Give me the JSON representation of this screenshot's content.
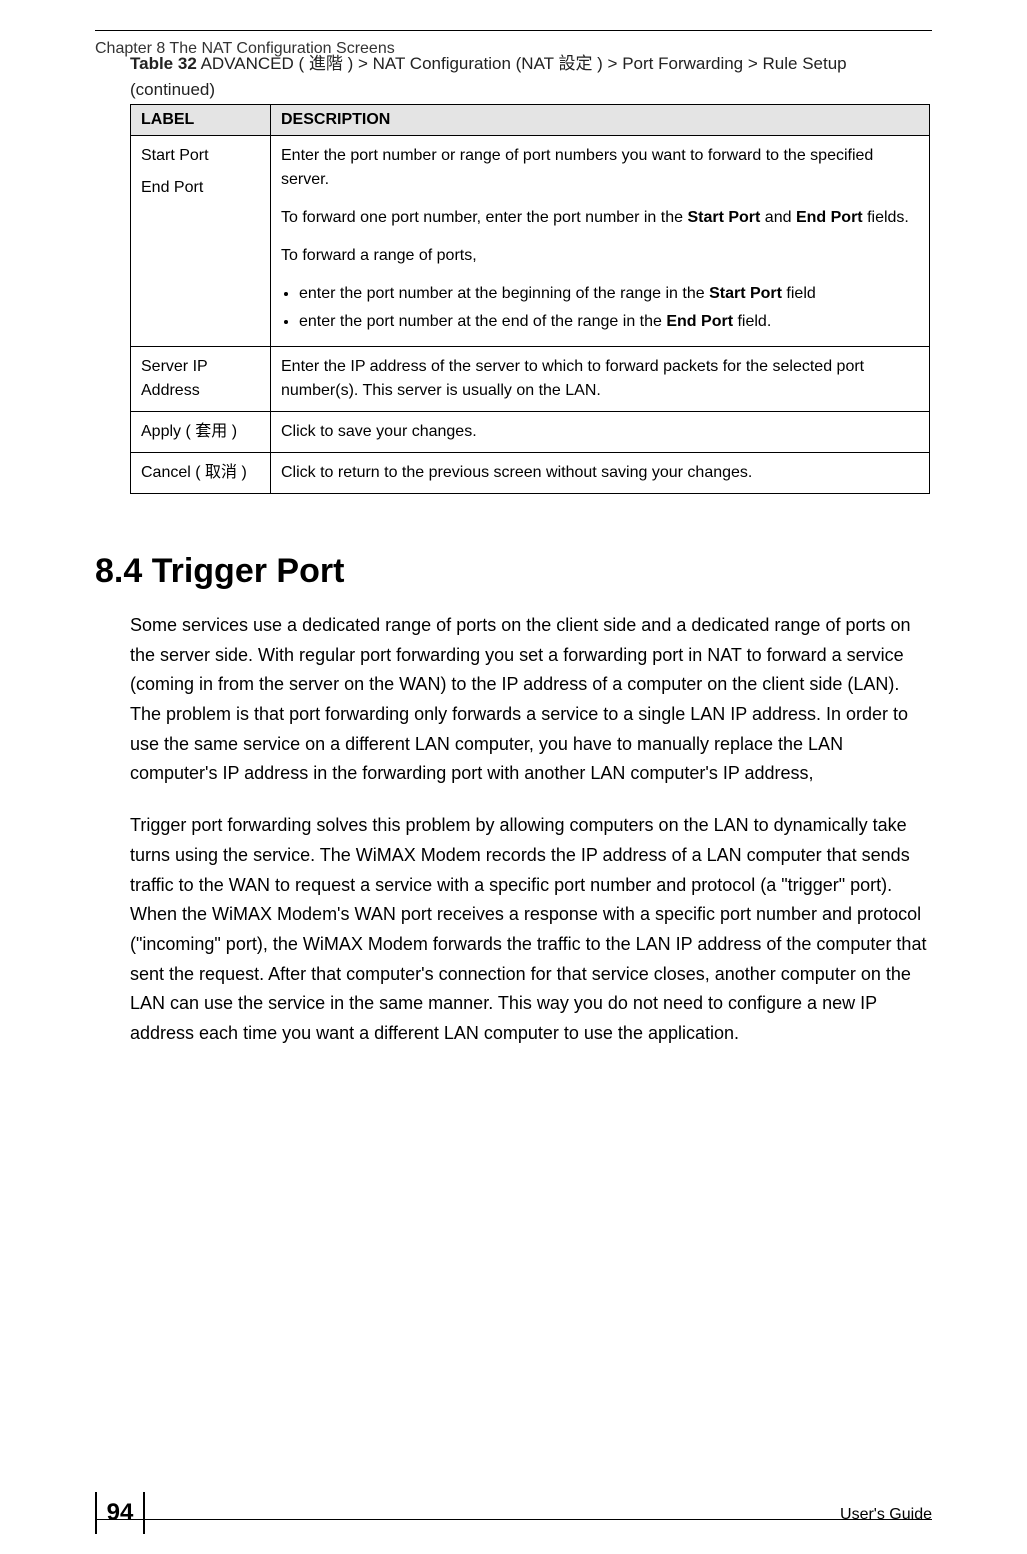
{
  "chapter_title": "Chapter 8 The NAT Configuration Screens",
  "table_caption_prefix": "Table 32",
  "table_caption_text": "   ADVANCED ( 進階 ) > NAT Configuration (NAT 設定 )  > Port Forwarding > Rule Setup (continued)",
  "table": {
    "header_label": "LABEL",
    "header_description": "DESCRIPTION",
    "rows": [
      {
        "label_line1": "Start Port",
        "label_line2": "End Port",
        "desc1": "Enter the port number or range of port numbers you want to forward to the specified server.",
        "desc2_a": "To forward one port number, enter the port number in the ",
        "desc2_b1": "Start Port",
        "desc2_c": " and ",
        "desc2_b2": "End Port",
        "desc2_d": " fields.",
        "desc3": "To forward a range of ports,",
        "bullet1_a": "enter the port number at the beginning of the range in the ",
        "bullet1_b": "Start Port",
        "bullet1_c": " field",
        "bullet2_a": "enter the port number at the end of the range in the ",
        "bullet2_b": "End Port",
        "bullet2_c": " field."
      },
      {
        "label": "Server IP Address",
        "desc": "Enter the IP address of the server to which to forward packets for the selected port number(s). This server is usually on the LAN."
      },
      {
        "label": "Apply ( 套用 )",
        "desc": "Click to save your changes."
      },
      {
        "label": "Cancel ( 取消 )",
        "desc": "Click to return to the previous screen without saving your changes."
      }
    ]
  },
  "section_heading": "8.4  Trigger Port",
  "para1": "Some services use a dedicated range of ports on the client side and a dedicated range of ports on the server side. With regular port forwarding you set a forwarding port in NAT to forward a service (coming in from the server on the WAN) to the IP address of a computer on the client side (LAN). The problem is that port forwarding only forwards a service to a single LAN IP address. In order to use the same service on a different LAN computer, you have to manually replace the LAN computer's IP address in the forwarding port with another LAN computer's IP address,",
  "para2": "Trigger port forwarding solves this problem by allowing computers on the LAN to dynamically take turns using the service. The WiMAX Modem records the IP address of a LAN computer that sends traffic to the WAN to request a service with a specific port number and protocol (a \"trigger\" port). When the WiMAX Modem's WAN port receives a response with a specific port number and protocol (\"incoming\" port), the WiMAX Modem forwards the traffic to the LAN IP address of the computer that sent the request. After that computer's connection for that service closes, another computer on the LAN can use the service in the same manner. This way you do not need to configure a new IP address each time you want a different LAN computer to use the application.",
  "footer": {
    "page_number": "94",
    "guide_text": "User's Guide"
  }
}
